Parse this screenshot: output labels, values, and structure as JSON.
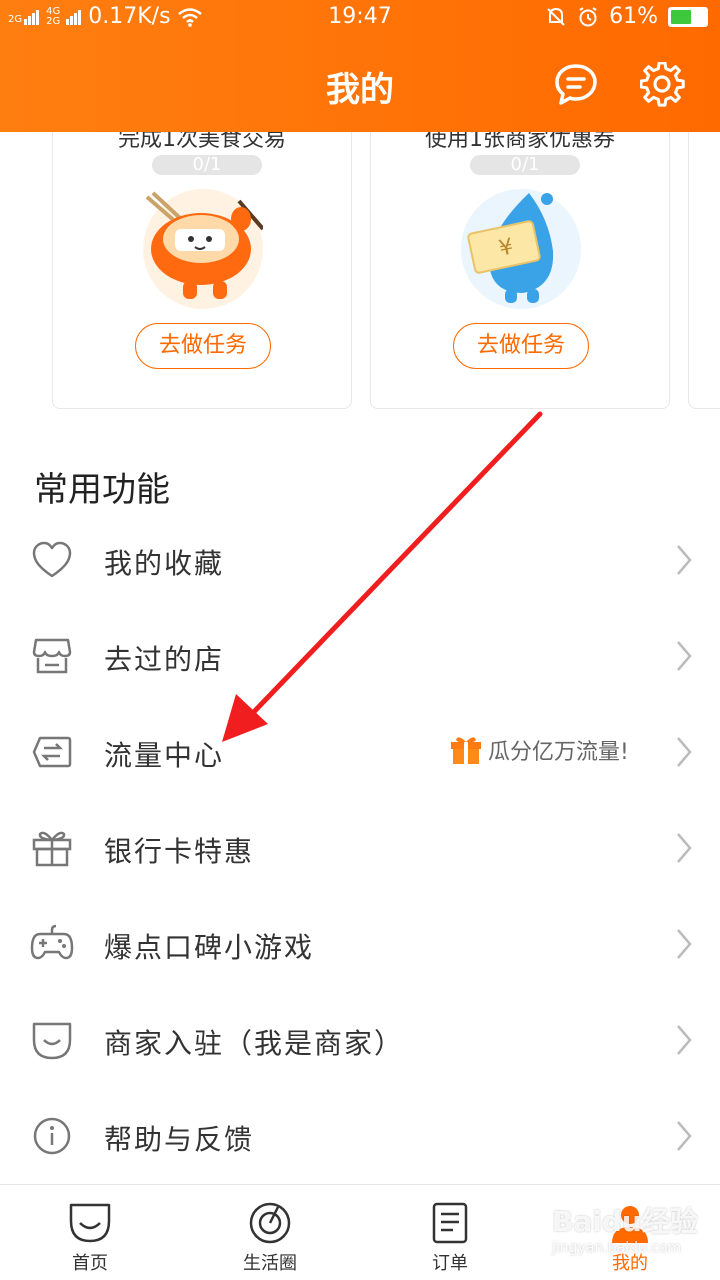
{
  "status_bar": {
    "signal_top": "2G",
    "signal_mid": "4G",
    "signal_bot": "2G",
    "speed": "0.17K/s",
    "time": "19:47",
    "battery": "61%",
    "battery_level": 0.61
  },
  "header": {
    "title": "我的",
    "message_icon": "message-icon",
    "settings_icon": "gear-icon"
  },
  "tasks": [
    {
      "title": "完成1次美食交易",
      "progress": "0/1",
      "button": "去做任务",
      "illustration": "food-mascot"
    },
    {
      "title": "使用1张商家优惠券",
      "progress": "0/1",
      "button": "去做任务",
      "illustration": "coupon-mascot"
    }
  ],
  "section": {
    "title": "常用功能"
  },
  "menu": [
    {
      "label": "我的收藏",
      "icon": "heart-icon"
    },
    {
      "label": "去过的店",
      "icon": "store-icon"
    },
    {
      "label": "流量中心",
      "icon": "data-transfer-icon",
      "promo": "瓜分亿万流量!"
    },
    {
      "label": "银行卡特惠",
      "icon": "gift-icon"
    },
    {
      "label": "爆点口碑小游戏",
      "icon": "gamepad-icon"
    },
    {
      "label": "商家入驻（我是商家）",
      "icon": "merchant-icon"
    },
    {
      "label": "帮助与反馈",
      "icon": "info-icon"
    }
  ],
  "tabbar": [
    {
      "label": "首页",
      "icon": "home-smile-icon"
    },
    {
      "label": "生活圈",
      "icon": "compass-icon"
    },
    {
      "label": "订单",
      "icon": "order-icon"
    },
    {
      "label": "我的",
      "icon": "profile-icon",
      "active": true
    }
  ],
  "watermark": {
    "main": "Baidu经验",
    "sub": "jingyan.baidu.com"
  },
  "colors": {
    "brand": "#ff6a00",
    "text": "#333333",
    "muted": "#999999",
    "card_border": "#e8e8e8"
  }
}
